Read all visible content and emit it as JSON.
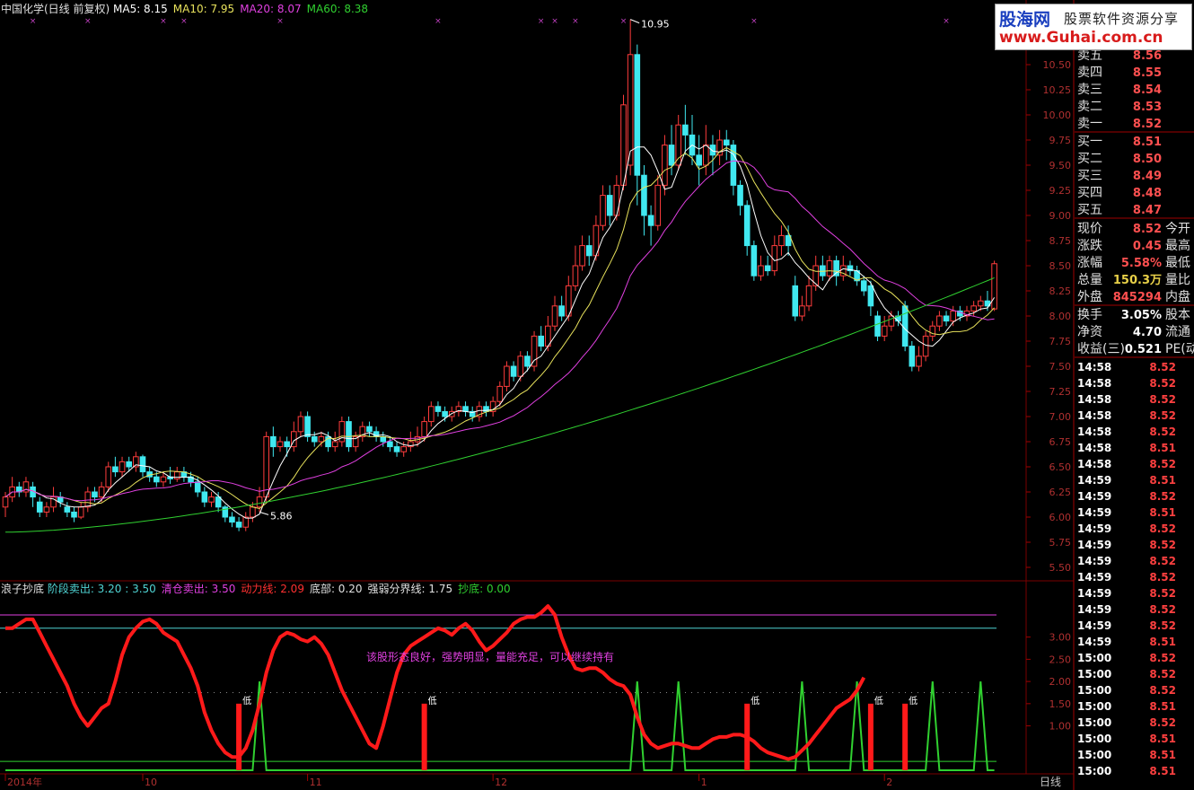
{
  "header": {
    "stock": "中国化学(日线 前复权)",
    "ma": [
      {
        "label": "MA5: 8.15",
        "color": "#ffffff"
      },
      {
        "label": "MA10: 7.95",
        "color": "#e8e25c"
      },
      {
        "label": "MA20: 8.07",
        "color": "#e040e0"
      },
      {
        "label": "MA60: 8.38",
        "color": "#30d030"
      }
    ]
  },
  "indicator": {
    "name": "浪子抄底",
    "items": [
      {
        "label": "阶段卖出: 3.20 : 3.50",
        "color": "#4fd3d3"
      },
      {
        "label": "清仓卖出: 3.50",
        "color": "#e040e0"
      },
      {
        "label": "动力线: 2.09",
        "color": "#ff3030"
      },
      {
        "label": "底部: 0.20",
        "color": "#e0e0e0"
      },
      {
        "label": "强弱分界线: 1.75",
        "color": "#e0e0e0"
      },
      {
        "label": "抄底: 0.00",
        "color": "#30d030"
      }
    ],
    "comment": "该股形态良好，强势明显，量能充足，可以继续持有",
    "low_label": "低"
  },
  "banner": {
    "logo": "股海网",
    "tag": "股票软件资源分享",
    "url": "www.Guhai.com.cn"
  },
  "bottom_label": "日线",
  "order_book": [
    {
      "label": "卖五",
      "value": "8.56"
    },
    {
      "label": "卖四",
      "value": "8.55"
    },
    {
      "label": "卖三",
      "value": "8.54"
    },
    {
      "label": "卖二",
      "value": "8.53"
    },
    {
      "label": "卖一",
      "value": "8.52"
    },
    {
      "label": "买一",
      "value": "8.51"
    },
    {
      "label": "买二",
      "value": "8.50"
    },
    {
      "label": "买三",
      "value": "8.49"
    },
    {
      "label": "买四",
      "value": "8.48"
    },
    {
      "label": "买五",
      "value": "8.47"
    }
  ],
  "quote_rows": [
    {
      "label": "现价",
      "value": "8.52",
      "vcolor": "#ff5050",
      "right": "今开"
    },
    {
      "label": "涨跌",
      "value": "0.45",
      "vcolor": "#ff5050",
      "right": "最高"
    },
    {
      "label": "涨幅",
      "value": "5.58%",
      "vcolor": "#ff5050",
      "right": "最低"
    },
    {
      "label": "总量",
      "value": "150.3万",
      "vcolor": "#e8d048",
      "right": "量比"
    },
    {
      "label": "外盘",
      "value": "845294",
      "vcolor": "#ff5050",
      "right": "内盘"
    },
    {
      "label": "换手",
      "value": "3.05%",
      "vcolor": "#ffffff",
      "right": "股本"
    },
    {
      "label": "净资",
      "value": "4.70",
      "vcolor": "#ffffff",
      "right": "流通"
    },
    {
      "label": "收益(三)",
      "value": "0.521",
      "vcolor": "#ffffff",
      "right": "PE(动"
    }
  ],
  "ticks": [
    {
      "time": "14:58",
      "price": "8.52"
    },
    {
      "time": "14:58",
      "price": "8.52"
    },
    {
      "time": "14:58",
      "price": "8.52"
    },
    {
      "time": "14:58",
      "price": "8.52"
    },
    {
      "time": "14:58",
      "price": "8.52"
    },
    {
      "time": "14:58",
      "price": "8.51"
    },
    {
      "time": "14:58",
      "price": "8.52"
    },
    {
      "time": "14:59",
      "price": "8.51"
    },
    {
      "time": "14:59",
      "price": "8.52"
    },
    {
      "time": "14:59",
      "price": "8.51"
    },
    {
      "time": "14:59",
      "price": "8.52"
    },
    {
      "time": "14:59",
      "price": "8.52"
    },
    {
      "time": "14:59",
      "price": "8.52"
    },
    {
      "time": "14:59",
      "price": "8.52"
    },
    {
      "time": "14:59",
      "price": "8.52"
    },
    {
      "time": "14:59",
      "price": "8.52"
    },
    {
      "time": "14:59",
      "price": "8.52"
    },
    {
      "time": "14:59",
      "price": "8.51"
    },
    {
      "time": "15:00",
      "price": "8.52"
    },
    {
      "time": "15:00",
      "price": "8.52"
    },
    {
      "time": "15:00",
      "price": "8.52"
    },
    {
      "time": "15:00",
      "price": "8.51"
    },
    {
      "time": "15:00",
      "price": "8.52"
    },
    {
      "time": "15:00",
      "price": "8.51"
    },
    {
      "time": "15:00",
      "price": "8.51"
    },
    {
      "time": "15:00",
      "price": "8.51"
    }
  ],
  "colors": {
    "up": "#ff3c3c",
    "down": "#40e8f0",
    "grid": "#7a0000",
    "ma5": "#ffffff",
    "ma10": "#e8e25c",
    "ma20": "#e040e0",
    "ma60": "#30d030",
    "power": "#ff1a1a",
    "bottom": "#30d030",
    "sell_stage": "#4fd3d3",
    "sell_clear": "#e040e0"
  },
  "chart_data": {
    "type": "candlestick",
    "price_axis": {
      "min": 5.5,
      "max": 10.5,
      "ticks": [
        "5.50",
        "5.75",
        "6.00",
        "6.25",
        "6.50",
        "6.75",
        "7.00",
        "7.25",
        "7.50",
        "7.75",
        "8.00",
        "8.25",
        "8.50",
        "8.75",
        "9.00",
        "9.25",
        "9.50",
        "9.75",
        "10.00",
        "10.25",
        "10.50"
      ]
    },
    "x_labels": [
      "2014年",
      "10",
      "11",
      "12",
      "1",
      "2"
    ],
    "x_label_index": [
      0,
      20,
      44,
      71,
      101,
      128
    ],
    "annotations": [
      {
        "text": "10.95",
        "index": 91
      },
      {
        "text": "5.86",
        "index": 37
      }
    ],
    "candles": [
      [
        6.1,
        6.2,
        6.0,
        6.25
      ],
      [
        6.2,
        6.3,
        6.15,
        6.4
      ],
      [
        6.3,
        6.25,
        6.2,
        6.35
      ],
      [
        6.25,
        6.35,
        6.2,
        6.4
      ],
      [
        6.3,
        6.2,
        6.1,
        6.35
      ],
      [
        6.15,
        6.05,
        6.0,
        6.2
      ],
      [
        6.05,
        6.1,
        6.0,
        6.15
      ],
      [
        6.1,
        6.2,
        6.05,
        6.3
      ],
      [
        6.2,
        6.15,
        6.1,
        6.25
      ],
      [
        6.1,
        6.05,
        6.0,
        6.15
      ],
      [
        6.05,
        6.0,
        5.95,
        6.1
      ],
      [
        6.0,
        6.1,
        5.98,
        6.15
      ],
      [
        6.1,
        6.25,
        6.05,
        6.3
      ],
      [
        6.25,
        6.2,
        6.15,
        6.3
      ],
      [
        6.2,
        6.3,
        6.15,
        6.35
      ],
      [
        6.3,
        6.5,
        6.25,
        6.55
      ],
      [
        6.5,
        6.45,
        6.4,
        6.6
      ],
      [
        6.45,
        6.55,
        6.4,
        6.6
      ],
      [
        6.55,
        6.5,
        6.45,
        6.6
      ],
      [
        6.5,
        6.6,
        6.45,
        6.65
      ],
      [
        6.6,
        6.45,
        6.4,
        6.62
      ],
      [
        6.45,
        6.4,
        6.35,
        6.5
      ],
      [
        6.4,
        6.35,
        6.3,
        6.45
      ],
      [
        6.35,
        6.4,
        6.3,
        6.45
      ],
      [
        6.4,
        6.38,
        6.33,
        6.5
      ],
      [
        6.38,
        6.45,
        6.35,
        6.5
      ],
      [
        6.45,
        6.4,
        6.35,
        6.5
      ],
      [
        6.4,
        6.35,
        6.3,
        6.45
      ],
      [
        6.35,
        6.25,
        6.2,
        6.4
      ],
      [
        6.25,
        6.15,
        6.1,
        6.3
      ],
      [
        6.15,
        6.2,
        6.1,
        6.25
      ],
      [
        6.2,
        6.1,
        6.05,
        6.25
      ],
      [
        6.1,
        6.0,
        5.95,
        6.12
      ],
      [
        6.0,
        5.95,
        5.9,
        6.05
      ],
      [
        5.95,
        5.9,
        5.86,
        6.0
      ],
      [
        5.9,
        6.0,
        5.86,
        6.05
      ],
      [
        6.0,
        6.1,
        5.95,
        6.15
      ],
      [
        6.1,
        6.2,
        6.05,
        6.3
      ],
      [
        6.2,
        6.8,
        6.15,
        6.85
      ],
      [
        6.8,
        6.7,
        6.6,
        6.9
      ],
      [
        6.7,
        6.75,
        6.65,
        6.8
      ],
      [
        6.75,
        6.7,
        6.6,
        6.8
      ],
      [
        6.7,
        6.85,
        6.65,
        6.95
      ],
      [
        6.85,
        7.0,
        6.8,
        7.05
      ],
      [
        7.0,
        6.8,
        6.75,
        7.05
      ],
      [
        6.8,
        6.75,
        6.7,
        6.85
      ],
      [
        6.75,
        6.8,
        6.7,
        6.85
      ],
      [
        6.8,
        6.7,
        6.65,
        6.85
      ],
      [
        6.7,
        6.75,
        6.65,
        6.85
      ],
      [
        6.75,
        6.95,
        6.7,
        7.0
      ],
      [
        6.95,
        6.7,
        6.65,
        7.0
      ],
      [
        6.7,
        6.8,
        6.65,
        6.85
      ],
      [
        6.8,
        6.9,
        6.75,
        6.95
      ],
      [
        6.9,
        6.85,
        6.8,
        6.95
      ],
      [
        6.85,
        6.8,
        6.75,
        6.9
      ],
      [
        6.8,
        6.75,
        6.7,
        6.85
      ],
      [
        6.75,
        6.7,
        6.65,
        6.8
      ],
      [
        6.7,
        6.65,
        6.6,
        6.75
      ],
      [
        6.65,
        6.7,
        6.6,
        6.75
      ],
      [
        6.7,
        6.75,
        6.65,
        6.85
      ],
      [
        6.75,
        6.8,
        6.7,
        6.9
      ],
      [
        6.8,
        6.95,
        6.75,
        7.0
      ],
      [
        6.95,
        7.1,
        6.9,
        7.15
      ],
      [
        7.1,
        7.05,
        7.0,
        7.15
      ],
      [
        7.05,
        7.0,
        6.95,
        7.1
      ],
      [
        7.0,
        7.05,
        6.95,
        7.1
      ],
      [
        7.05,
        7.1,
        7.0,
        7.15
      ],
      [
        7.1,
        7.05,
        7.0,
        7.15
      ],
      [
        7.05,
        7.0,
        6.95,
        7.1
      ],
      [
        7.0,
        7.1,
        6.95,
        7.15
      ],
      [
        7.1,
        7.05,
        7.0,
        7.15
      ],
      [
        7.05,
        7.15,
        7.0,
        7.2
      ],
      [
        7.15,
        7.3,
        7.1,
        7.35
      ],
      [
        7.3,
        7.5,
        7.25,
        7.55
      ],
      [
        7.5,
        7.4,
        7.35,
        7.55
      ],
      [
        7.4,
        7.6,
        7.35,
        7.65
      ],
      [
        7.6,
        7.5,
        7.45,
        7.65
      ],
      [
        7.5,
        7.8,
        7.45,
        7.85
      ],
      [
        7.8,
        7.7,
        7.65,
        7.9
      ],
      [
        7.7,
        7.9,
        7.65,
        8.0
      ],
      [
        7.9,
        8.1,
        7.85,
        8.2
      ],
      [
        8.1,
        8.0,
        7.95,
        8.2
      ],
      [
        8.0,
        8.3,
        7.95,
        8.4
      ],
      [
        8.3,
        8.5,
        8.25,
        8.7
      ],
      [
        8.5,
        8.7,
        8.45,
        8.8
      ],
      [
        8.7,
        8.6,
        8.5,
        8.8
      ],
      [
        8.6,
        8.9,
        8.55,
        9.0
      ],
      [
        8.9,
        9.2,
        8.85,
        9.3
      ],
      [
        9.2,
        9.0,
        8.9,
        9.3
      ],
      [
        9.0,
        9.3,
        8.95,
        9.4
      ],
      [
        9.3,
        10.1,
        9.25,
        10.2
      ],
      [
        9.5,
        10.6,
        9.4,
        10.95
      ],
      [
        10.6,
        9.4,
        9.1,
        10.7
      ],
      [
        9.4,
        9.0,
        8.8,
        9.5
      ],
      [
        9.0,
        8.9,
        8.7,
        9.1
      ],
      [
        8.9,
        9.3,
        8.85,
        9.4
      ],
      [
        9.3,
        9.7,
        9.2,
        9.8
      ],
      [
        9.7,
        9.5,
        9.4,
        9.9
      ],
      [
        9.5,
        9.9,
        9.45,
        10.0
      ],
      [
        9.9,
        9.8,
        9.6,
        10.1
      ],
      [
        9.8,
        9.6,
        9.5,
        10.0
      ],
      [
        9.6,
        9.5,
        9.3,
        9.8
      ],
      [
        9.5,
        9.7,
        9.4,
        9.9
      ],
      [
        9.7,
        9.6,
        9.4,
        9.8
      ],
      [
        9.6,
        9.75,
        9.5,
        9.85
      ],
      [
        9.75,
        9.7,
        9.55,
        9.85
      ],
      [
        9.7,
        9.3,
        9.2,
        9.75
      ],
      [
        9.3,
        9.1,
        9.0,
        9.35
      ],
      [
        9.1,
        8.7,
        8.6,
        9.15
      ],
      [
        8.7,
        8.4,
        8.35,
        8.75
      ],
      [
        8.4,
        8.5,
        8.35,
        8.6
      ],
      [
        8.5,
        8.45,
        8.4,
        8.6
      ],
      [
        8.45,
        8.7,
        8.4,
        8.8
      ],
      [
        8.7,
        8.8,
        8.6,
        8.9
      ],
      [
        8.8,
        8.7,
        8.6,
        8.9
      ],
      [
        8.3,
        8.0,
        7.95,
        8.4
      ],
      [
        8.0,
        8.1,
        7.95,
        8.2
      ],
      [
        8.1,
        8.3,
        8.05,
        8.4
      ],
      [
        8.3,
        8.5,
        8.25,
        8.6
      ],
      [
        8.5,
        8.4,
        8.35,
        8.6
      ],
      [
        8.4,
        8.55,
        8.35,
        8.6
      ],
      [
        8.55,
        8.4,
        8.3,
        8.6
      ],
      [
        8.4,
        8.5,
        8.35,
        8.6
      ],
      [
        8.5,
        8.45,
        8.4,
        8.55
      ],
      [
        8.45,
        8.35,
        8.3,
        8.5
      ],
      [
        8.35,
        8.25,
        8.2,
        8.4
      ],
      [
        8.3,
        8.1,
        8.0,
        8.35
      ],
      [
        8.0,
        7.8,
        7.75,
        8.05
      ],
      [
        7.8,
        7.9,
        7.75,
        8.0
      ],
      [
        7.9,
        8.0,
        7.85,
        8.05
      ],
      [
        8.0,
        7.95,
        7.9,
        8.05
      ],
      [
        8.1,
        7.7,
        7.65,
        8.15
      ],
      [
        7.7,
        7.5,
        7.45,
        7.75
      ],
      [
        7.5,
        7.6,
        7.45,
        7.7
      ],
      [
        7.6,
        7.8,
        7.55,
        7.85
      ],
      [
        7.8,
        7.9,
        7.75,
        7.95
      ],
      [
        7.9,
        8.0,
        7.85,
        8.05
      ],
      [
        8.0,
        7.95,
        7.9,
        8.05
      ],
      [
        7.95,
        8.05,
        7.9,
        8.1
      ],
      [
        8.05,
        8.0,
        7.95,
        8.1
      ],
      [
        8.0,
        8.05,
        7.95,
        8.1
      ],
      [
        8.05,
        8.1,
        8.0,
        8.15
      ],
      [
        8.1,
        8.15,
        8.05,
        8.2
      ],
      [
        8.15,
        8.1,
        8.05,
        8.25
      ],
      [
        8.07,
        8.52,
        8.05,
        8.55
      ]
    ],
    "indicator": {
      "levels": {
        "sell_clear": 3.5,
        "sell_stage": 3.2,
        "strong_weak": 1.75,
        "bottom": 0.2
      },
      "y_ticks": [
        "1.00",
        "1.50",
        "2.00",
        "2.50",
        "3.00"
      ],
      "power": [
        3.2,
        3.2,
        3.3,
        3.4,
        3.4,
        3.1,
        2.8,
        2.5,
        2.2,
        1.9,
        1.5,
        1.2,
        1.0,
        1.2,
        1.4,
        1.5,
        2.0,
        2.6,
        3.0,
        3.2,
        3.35,
        3.4,
        3.3,
        3.1,
        3.0,
        2.9,
        2.6,
        2.3,
        1.9,
        1.3,
        0.9,
        0.6,
        0.4,
        0.3,
        0.3,
        0.5,
        0.9,
        1.5,
        2.2,
        2.7,
        3.0,
        3.1,
        3.05,
        2.95,
        2.9,
        3.0,
        2.85,
        2.6,
        2.2,
        1.8,
        1.5,
        1.2,
        0.9,
        0.6,
        0.5,
        1.0,
        1.6,
        2.2,
        2.6,
        2.8,
        2.9,
        3.0,
        3.1,
        3.2,
        3.15,
        3.05,
        3.2,
        3.3,
        3.15,
        2.9,
        2.7,
        2.8,
        2.95,
        3.1,
        3.3,
        3.4,
        3.45,
        3.45,
        3.55,
        3.7,
        3.5,
        3.0,
        2.6,
        2.3,
        2.25,
        2.3,
        2.3,
        2.2,
        2.05,
        1.95,
        1.9,
        1.7,
        1.2,
        0.8,
        0.6,
        0.5,
        0.55,
        0.6,
        0.6,
        0.55,
        0.5,
        0.5,
        0.6,
        0.7,
        0.75,
        0.75,
        0.8,
        0.8,
        0.75,
        0.65,
        0.5,
        0.4,
        0.35,
        0.3,
        0.25,
        0.3,
        0.45,
        0.6,
        0.8,
        1.0,
        1.2,
        1.4,
        1.5,
        1.6,
        1.8,
        2.09
      ],
      "bottom_spikes": [
        37,
        92,
        98,
        116,
        124,
        135,
        142
      ],
      "low_marks": [
        34,
        61,
        108,
        126,
        131
      ]
    }
  }
}
